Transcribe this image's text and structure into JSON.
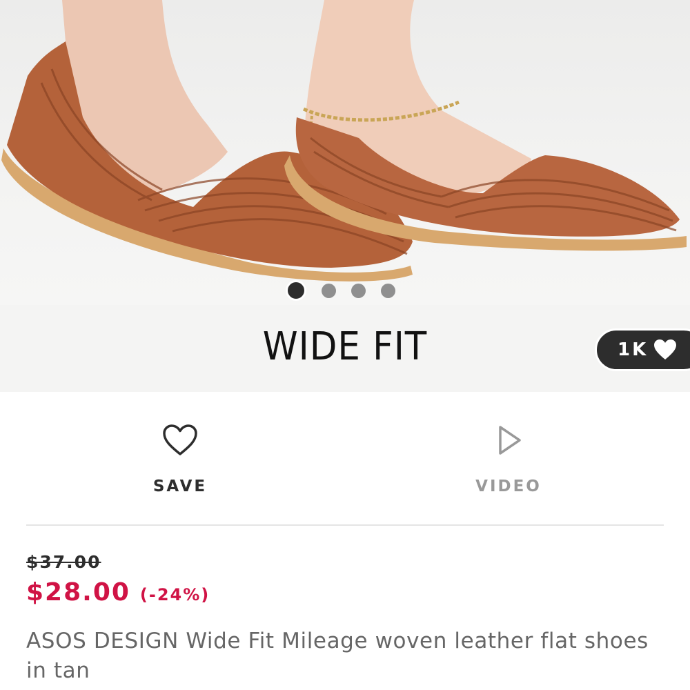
{
  "image": {
    "banner_text": "WIDE FIT",
    "carousel": {
      "total": 4,
      "active_index": 0
    },
    "likes": {
      "count": "1K",
      "icon": "heart-filled-icon"
    }
  },
  "actions": {
    "save": {
      "label": "SAVE",
      "icon": "heart-outline-icon"
    },
    "video": {
      "label": "VIDEO",
      "icon": "play-outline-icon"
    }
  },
  "pricing": {
    "original_price": "$37.00",
    "sale_price": "$28.00",
    "discount": "(-24%)"
  },
  "product": {
    "name": "ASOS DESIGN Wide Fit Mileage woven leather flat shoes in tan"
  },
  "colors": {
    "sale": "#d01345",
    "text_dark": "#2d2d2d",
    "text_muted": "#999999",
    "leather_tan": "#b4623a"
  }
}
